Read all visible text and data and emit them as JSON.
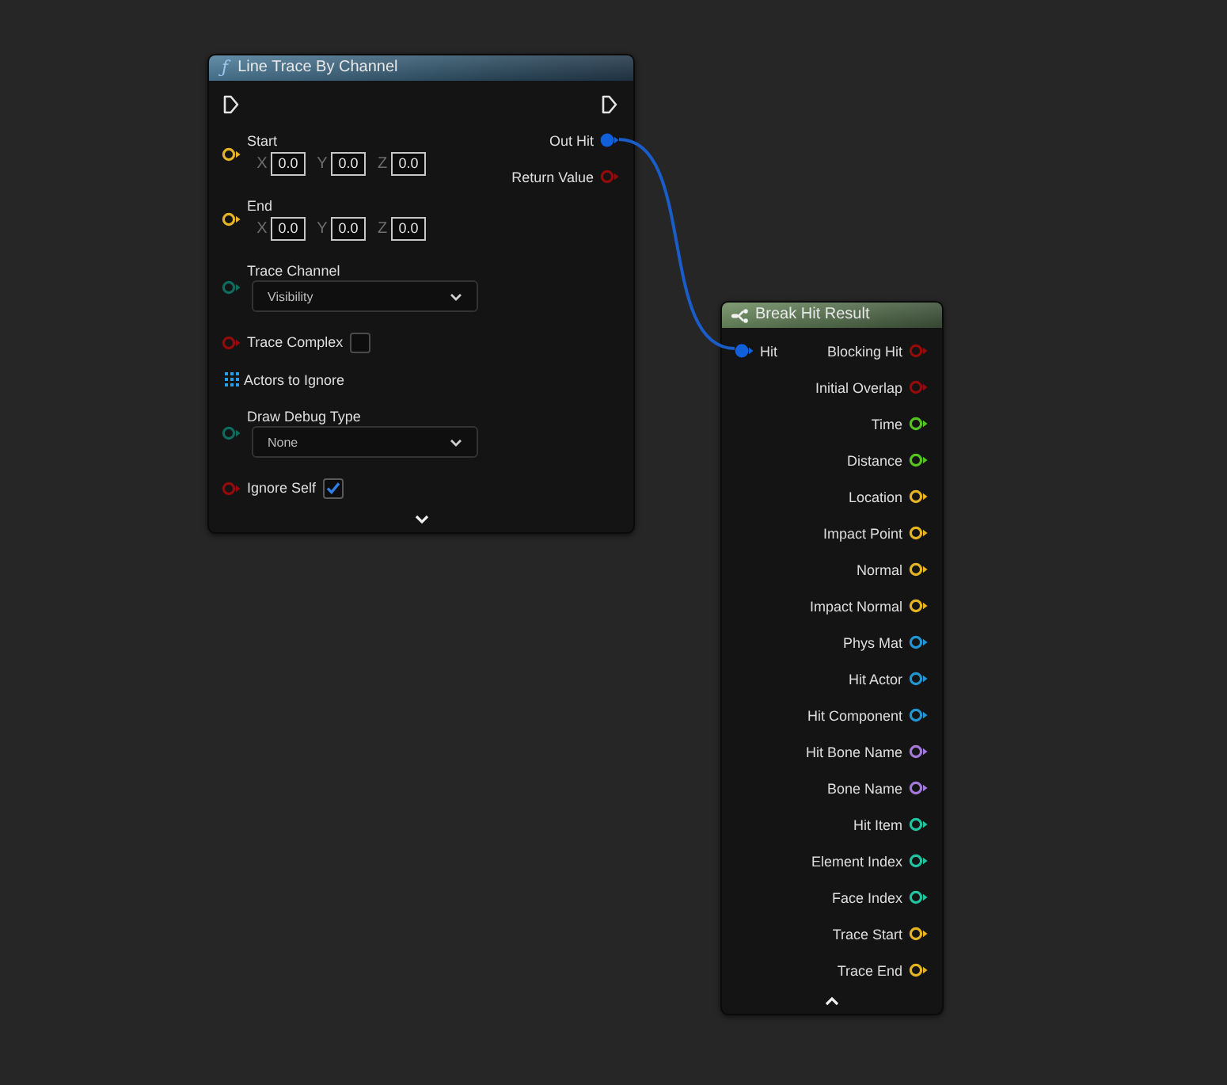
{
  "nodes": [
    {
      "kind": "function",
      "icon": "ƒ",
      "title": "Line Trace By Channel",
      "exec_in": true,
      "exec_out": true,
      "inputs": [
        {
          "kind": "vector",
          "label": "Start",
          "color": "#e5b422",
          "connected": false,
          "components": [
            {
              "axis": "X",
              "value": "0.0"
            },
            {
              "axis": "Y",
              "value": "0.0"
            },
            {
              "axis": "Z",
              "value": "0.0"
            }
          ]
        },
        {
          "kind": "vector",
          "label": "End",
          "color": "#e5b422",
          "connected": false,
          "components": [
            {
              "axis": "X",
              "value": "0.0"
            },
            {
              "axis": "Y",
              "value": "0.0"
            },
            {
              "axis": "Z",
              "value": "0.0"
            }
          ]
        },
        {
          "kind": "enum",
          "label": "Trace Channel",
          "color": "#0f6b60",
          "connected": false,
          "value": "Visibility"
        },
        {
          "kind": "bool",
          "label": "Trace Complex",
          "color": "#930b0b",
          "connected": false,
          "checked": false
        },
        {
          "kind": "array",
          "label": "Actors to Ignore",
          "color": "#2a9ee6"
        },
        {
          "kind": "enum",
          "label": "Draw Debug Type",
          "color": "#0f6b60",
          "connected": false,
          "value": "None"
        },
        {
          "kind": "bool",
          "label": "Ignore Self",
          "color": "#930b0b",
          "connected": false,
          "checked": true
        }
      ],
      "outputs": [
        {
          "label": "Out Hit",
          "color": "#1060dc",
          "connected": true
        },
        {
          "label": "Return Value",
          "color": "#930b0b",
          "connected": false
        }
      ],
      "advanced_expanded": false
    },
    {
      "kind": "break",
      "title": "Break Hit Result",
      "inputs": [
        {
          "kind": "struct",
          "label": "Hit",
          "color": "#1060dc",
          "connected": true
        }
      ],
      "outputs": [
        {
          "label": "Blocking Hit",
          "color": "#930b0b",
          "connected": false
        },
        {
          "label": "Initial Overlap",
          "color": "#930b0b",
          "connected": false
        },
        {
          "label": "Time",
          "color": "#56c41e",
          "connected": false
        },
        {
          "label": "Distance",
          "color": "#56c41e",
          "connected": false
        },
        {
          "label": "Location",
          "color": "#e5b422",
          "connected": false
        },
        {
          "label": "Impact Point",
          "color": "#e5b422",
          "connected": false
        },
        {
          "label": "Normal",
          "color": "#e5b422",
          "connected": false
        },
        {
          "label": "Impact Normal",
          "color": "#e5b422",
          "connected": false
        },
        {
          "label": "Phys Mat",
          "color": "#2196d3",
          "connected": false
        },
        {
          "label": "Hit Actor",
          "color": "#2196d3",
          "connected": false
        },
        {
          "label": "Hit Component",
          "color": "#2196d3",
          "connected": false
        },
        {
          "label": "Hit Bone Name",
          "color": "#a478d9",
          "connected": false
        },
        {
          "label": "Bone Name",
          "color": "#a478d9",
          "connected": false
        },
        {
          "label": "Hit Item",
          "color": "#20c4a0",
          "connected": false
        },
        {
          "label": "Element Index",
          "color": "#20c4a0",
          "connected": false
        },
        {
          "label": "Face Index",
          "color": "#20c4a0",
          "connected": false
        },
        {
          "label": "Trace Start",
          "color": "#e5b422",
          "connected": false
        },
        {
          "label": "Trace End",
          "color": "#e5b422",
          "connected": false
        }
      ],
      "advanced_expanded": true
    }
  ]
}
